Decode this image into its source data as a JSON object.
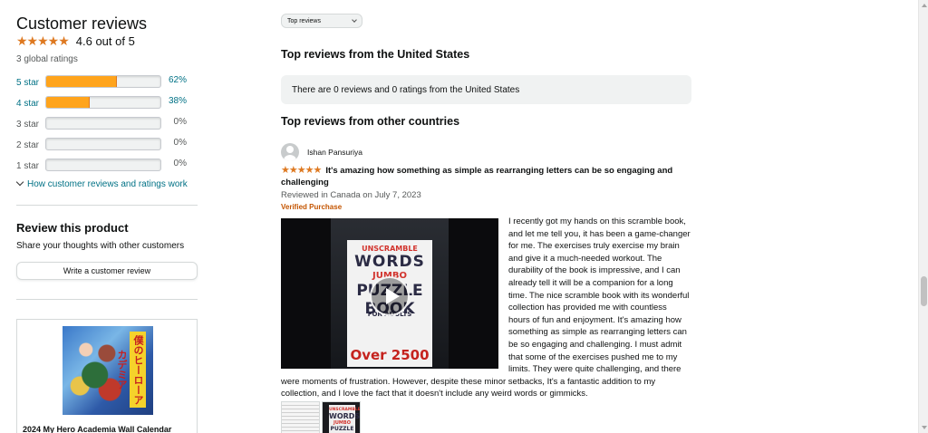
{
  "summary": {
    "title": "Customer reviews",
    "stars": "★★★★★",
    "rating_text": "4.6 out of 5",
    "global_ratings": "3 global ratings"
  },
  "histogram": [
    {
      "label": "5 star",
      "percent_text": "62%",
      "fill": 0.62
    },
    {
      "label": "4 star",
      "percent_text": "38%",
      "fill": 0.38
    },
    {
      "label": "3 star",
      "percent_text": "0%",
      "fill": 0
    },
    {
      "label": "2 star",
      "percent_text": "0%",
      "fill": 0
    },
    {
      "label": "1 star",
      "percent_text": "0%",
      "fill": 0
    }
  ],
  "how_link": "How customer reviews and ratings work",
  "review_product": {
    "title": "Review this product",
    "subtitle": "Share your thoughts with other customers",
    "button": "Write a customer review"
  },
  "ad": {
    "title": "2024 My Hero Academia Wall Calendar",
    "spine_text": "僕のヒーローアカデミア"
  },
  "sort": {
    "selected": "Top reviews"
  },
  "sections": {
    "us_heading": "Top reviews from the United States",
    "us_empty": "There are 0 reviews and 0 ratings from the United States",
    "other_heading": "Top reviews from other countries"
  },
  "review": {
    "reviewer": "Ishan Pansuriya",
    "stars": "★★★★★",
    "title": "It's amazing how something as simple as rearranging letters can be so engaging and challenging",
    "date": "Reviewed in Canada on July 7, 2023",
    "verified": "Verified Purchase",
    "body": " I recently got my hands on this scramble book, and let me tell you, it has been a game-changer for me. The exercises truly exercise my brain and give it a much-needed workout. The durability of the book is impressive, and I can already tell it will be a companion for a long time. The nice scramble book with its wonderful collection has provided me with countless hours of fun and enjoyment. It's amazing how something as simple as rearranging letters can be so engaging and challenging. I must admit that some of the exercises pushed me to my limits. They were quite challenging, and there were moments of frustration. However, despite these minor setbacks, It's a fantastic addition to my collection, and I love the fact that it doesn't include any weird words or gimmicks.",
    "video_book": {
      "line1": "UNSCRAMBLE",
      "line2": "WORDS",
      "line3": "JUMBO",
      "line4": "PUZZLE BOOK",
      "line5": "FOR ADULTS",
      "line6": "Over 2500"
    },
    "thumb_book": {
      "line1": "UNSCRAMBLE",
      "line2": "WORDS",
      "line3": "JUMBO",
      "line4": "PUZZLE"
    }
  },
  "colors": {
    "star": "#de7921",
    "bar_fill": "#ffa41c",
    "link": "#007185",
    "verified": "#c45500",
    "empty_box": "#f0f2f2"
  }
}
